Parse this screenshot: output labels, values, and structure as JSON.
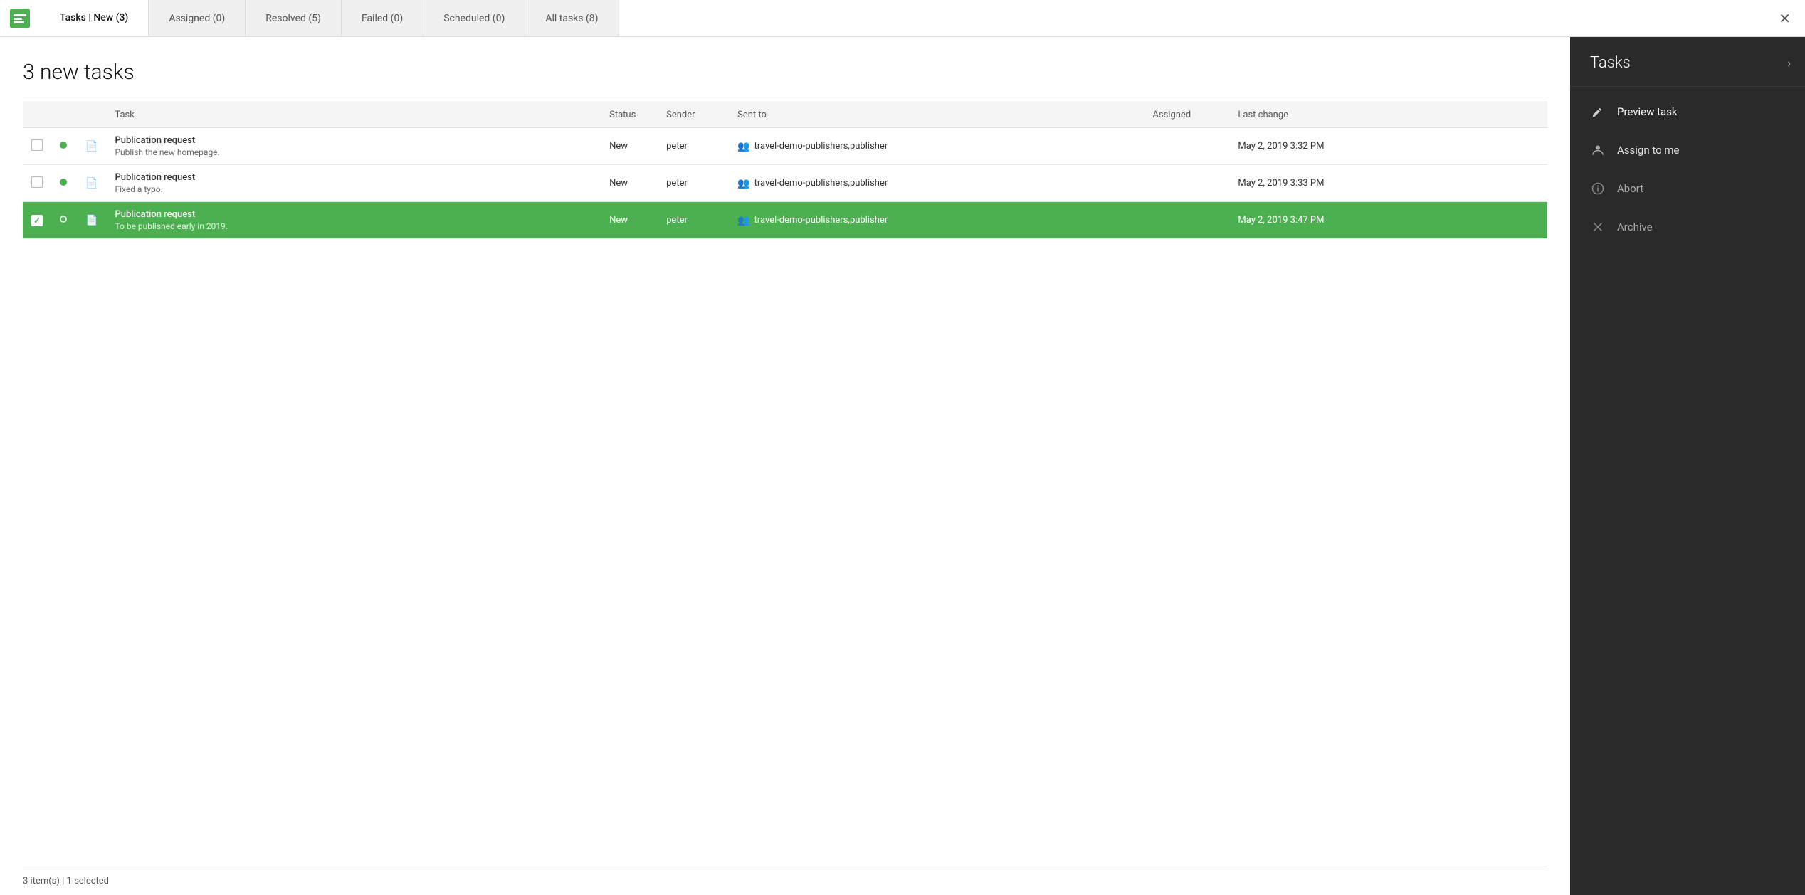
{
  "tabs": [
    {
      "id": "new",
      "label": "Tasks | New (3)",
      "active": true
    },
    {
      "id": "assigned",
      "label": "Assigned (0)",
      "active": false
    },
    {
      "id": "resolved",
      "label": "Resolved (5)",
      "active": false
    },
    {
      "id": "failed",
      "label": "Failed (0)",
      "active": false
    },
    {
      "id": "scheduled",
      "label": "Scheduled (0)",
      "active": false
    },
    {
      "id": "all",
      "label": "All tasks (8)",
      "active": false
    }
  ],
  "page_title": "3 new tasks",
  "table": {
    "columns": [
      "",
      "",
      "",
      "Task",
      "Status",
      "Sender",
      "Sent to",
      "Assigned",
      "Last change"
    ],
    "rows": [
      {
        "id": "row1",
        "selected": false,
        "dot": "green",
        "task_name": "Publication request",
        "task_desc": "Publish the new homepage.",
        "status": "New",
        "sender": "peter",
        "sent_to": "travel-demo-publishers,publisher",
        "assigned": "",
        "last_change": "May 2, 2019 3:32 PM"
      },
      {
        "id": "row2",
        "selected": false,
        "dot": "green",
        "task_name": "Publication request",
        "task_desc": "Fixed a typo.",
        "status": "New",
        "sender": "peter",
        "sent_to": "travel-demo-publishers,publisher",
        "assigned": "",
        "last_change": "May 2, 2019 3:33 PM"
      },
      {
        "id": "row3",
        "selected": true,
        "dot": "outline",
        "task_name": "Publication request",
        "task_desc": "To be published early in 2019.",
        "status": "New",
        "sender": "peter",
        "sent_to": "travel-demo-publishers,publisher",
        "assigned": "",
        "last_change": "May 2, 2019 3:47 PM"
      }
    ]
  },
  "status_bar": "3 item(s) | 1 selected",
  "right_panel": {
    "title": "Tasks",
    "actions": [
      {
        "id": "preview",
        "label": "Preview task",
        "icon": "pencil"
      },
      {
        "id": "assign",
        "label": "Assign to me",
        "icon": "person"
      },
      {
        "id": "abort",
        "label": "Abort",
        "icon": "info"
      },
      {
        "id": "archive",
        "label": "Archive",
        "icon": "x"
      }
    ]
  }
}
